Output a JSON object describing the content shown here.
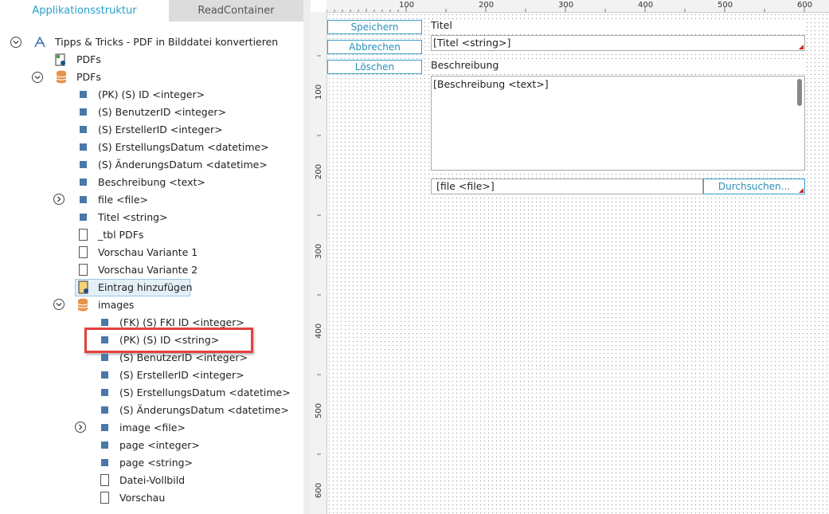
{
  "tabs": {
    "app": "Applikationsstruktur",
    "readcontainer": "ReadContainer"
  },
  "tree": {
    "root": "Tipps & Tricks - PDF in Bilddatei konvertieren",
    "pdfs_page": "PDFs",
    "pdfs_db": "PDFs",
    "pdfs_fields": [
      "(PK) (S) ID <integer>",
      "(S) BenutzerID <integer>",
      "(S) ErstellerID <integer>",
      "(S) ErstellungsDatum <datetime>",
      "(S) ÄnderungsDatum <datetime>",
      "Beschreibung <text>",
      "file <file>",
      "Titel <string>",
      "_tbl PDFs",
      "Vorschau Variante 1",
      "Vorschau Variante 2",
      "Eintrag hinzufügen"
    ],
    "images_db": "images",
    "images_fields": [
      "(FK) (S) FKI ID <integer>",
      "(PK) (S) ID <string>",
      "(S) BenutzerID <integer>",
      "(S) ErstellerID <integer>",
      "(S) ErstellungsDatum <datetime>",
      "(S) ÄnderungsDatum <datetime>",
      "image <file>",
      "page <integer>",
      "page <string>",
      "Datei-Vollbild",
      "Vorschau"
    ]
  },
  "ruler": {
    "top": [
      "100",
      "200",
      "300",
      "400",
      "500",
      "600"
    ],
    "left": [
      "100",
      "200",
      "300",
      "400",
      "500",
      "600"
    ]
  },
  "form": {
    "buttons": {
      "save": "Speichern",
      "cancel": "Abbrechen",
      "delete": "Löschen"
    },
    "titel_label": "Titel",
    "titel_value": "[Titel <string>]",
    "beschreibung_label": "Beschreibung",
    "beschreibung_value": "[Beschreibung <text>]",
    "file_value": "[file <file>]",
    "browse_label": "Durchsuchen..."
  },
  "colors": {
    "accent": "#2b9fc9",
    "highlight": "#e5413f",
    "field_icon": "#4a78a8"
  }
}
